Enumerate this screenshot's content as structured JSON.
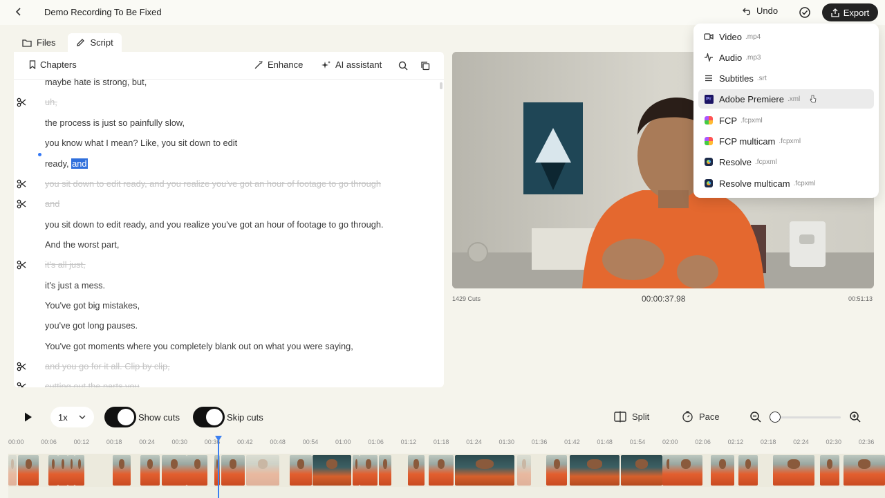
{
  "app": {
    "title": "Demo Recording To Be Fixed",
    "undo_label": "Undo",
    "export_label": "Export"
  },
  "tabs": [
    {
      "label": "Files",
      "icon": "folder-icon"
    },
    {
      "label": "Script",
      "icon": "pencil-icon",
      "active": true
    }
  ],
  "toolbar": {
    "chapters_label": "Chapters",
    "enhance_label": "Enhance",
    "ai_label": "AI assistant"
  },
  "transcript": [
    {
      "text": "maybe hate is strong, but,",
      "cut": false
    },
    {
      "text": "uh,",
      "cut": true
    },
    {
      "text": "the process is just so painfully slow,",
      "cut": false
    },
    {
      "text": "you know what I mean? Like, you sit down to edit",
      "cut": false
    },
    {
      "text": "ready, ",
      "highlight": "and",
      "cut": false
    },
    {
      "text": "you sit down to edit ready, and you realize you've got an hour of footage to go through",
      "cut": true
    },
    {
      "text": "and",
      "cut": true
    },
    {
      "text": "you sit down to edit ready, and you realize you've got an hour of footage to go through.",
      "cut": false
    },
    {
      "text": "And the worst part,",
      "cut": false
    },
    {
      "text": "it's all just,",
      "cut": true
    },
    {
      "text": "it's just a mess.",
      "cut": false
    },
    {
      "text": "You've got big mistakes,",
      "cut": false
    },
    {
      "text": "you've got long pauses.",
      "cut": false
    },
    {
      "text": "You've got moments where you completely blank out on what you were saying,",
      "cut": false
    },
    {
      "text": "and you go for it all. Clip by clip,",
      "cut": true
    },
    {
      "text": "cutting out the parts you",
      "cut": true
    }
  ],
  "video": {
    "cuts_count": "1429 Cuts",
    "timecode": "00:00:37.98",
    "duration": "00:51:13"
  },
  "export_menu": [
    {
      "label": "Video",
      "ext": ".mp4",
      "icon": "video-icon"
    },
    {
      "label": "Audio",
      "ext": ".mp3",
      "icon": "audio-wave-icon"
    },
    {
      "label": "Subtitles",
      "ext": ".srt",
      "icon": "subtitles-icon"
    },
    {
      "label": "Adobe Premiere",
      "ext": ".xml",
      "icon": "premiere-icon",
      "hovered": true
    },
    {
      "label": "FCP",
      "ext": ".fcpxml",
      "icon": "fcp-icon"
    },
    {
      "label": "FCP multicam",
      "ext": ".fcpxml",
      "icon": "fcp-icon"
    },
    {
      "label": "Resolve",
      "ext": ".fcpxml",
      "icon": "resolve-icon"
    },
    {
      "label": "Resolve multicam",
      "ext": ".fcpxml",
      "icon": "resolve-icon"
    }
  ],
  "controls": {
    "speed": "1x",
    "show_cuts_label": "Show cuts",
    "show_cuts_on": true,
    "skip_cuts_label": "Skip cuts",
    "skip_cuts_on": true,
    "split_label": "Split",
    "pace_label": "Pace",
    "zoom_level": 0.0
  },
  "timeline": {
    "ticks": [
      "00:00",
      "00:06",
      "00:12",
      "00:18",
      "00:24",
      "00:30",
      "00:36",
      "00:42",
      "00:48",
      "00:54",
      "01:00",
      "01:06",
      "01:12",
      "01:18",
      "01:24",
      "01:30",
      "01:36",
      "01:42",
      "01:48",
      "01:54",
      "02:00",
      "02:06",
      "02:12",
      "02:18",
      "02:24",
      "02:30",
      "02:36"
    ],
    "playhead_time": "00:37"
  },
  "colors": {
    "accent": "#3b7ff0",
    "highlight": "#2f6fdc",
    "dark_button": "#232323",
    "background": "#f5f4ec"
  }
}
